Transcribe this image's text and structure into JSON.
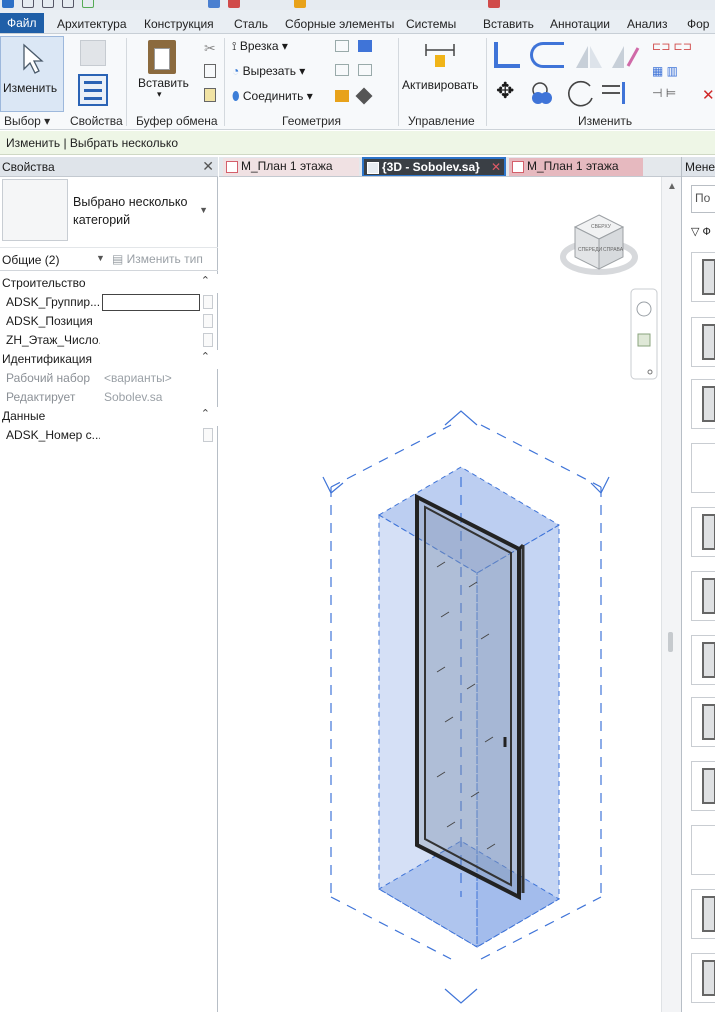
{
  "ribbon": {
    "tabs": [
      "Файл",
      "Архитектура",
      "Конструкция",
      "Сталь",
      "Сборные элементы",
      "Системы",
      "Вставить",
      "Аннотации",
      "Анализ",
      "Фор"
    ],
    "modify_label": "Изменить",
    "paste_label": "Вставить",
    "cut_menu": "Врезка",
    "cut_menu2": "Вырезать",
    "join_menu": "Соединить",
    "activate_label": "Активировать",
    "panels": {
      "select": "Выбор ▾",
      "properties": "Свойства",
      "clipboard": "Буфер обмена",
      "geometry": "Геометрия",
      "control": "Управление",
      "modify": "Изменить"
    }
  },
  "context_bar": "Изменить | Выбрать несколько",
  "properties": {
    "title": "Свойства",
    "type_line1": "Выбрано несколько",
    "type_line2": "категорий",
    "filter": "Общие (2)",
    "edit_type": "Изменить тип",
    "groups": [
      {
        "name": "Строительство",
        "rows": [
          {
            "key": "ADSK_Группир...",
            "value": ""
          },
          {
            "key": "ADSK_Позиция",
            "value": ""
          },
          {
            "key": "ZH_Этаж_Число...",
            "value": ""
          }
        ]
      },
      {
        "name": "Идентификация",
        "rows": [
          {
            "key": "Рабочий набор",
            "value": "<варианты>"
          },
          {
            "key": "Редактирует",
            "value": "Sobolev.sa"
          }
        ]
      },
      {
        "name": "Данные",
        "rows": [
          {
            "key": "ADSK_Номер с...",
            "value": ""
          }
        ]
      }
    ]
  },
  "view_tabs": [
    {
      "label": "М_План 1 этажа",
      "active": false
    },
    {
      "label": "{3D - Sobolev.sa}",
      "active": true
    },
    {
      "label": "М_План 1 этажа",
      "active": false
    }
  ],
  "viewcube": {
    "face_top": "СВЕРХУ",
    "face_front": "СПЕРЕДИ",
    "face_right": "СПРАВА"
  },
  "browser": {
    "title": "Менед",
    "search_placeholder": "По",
    "filter_label": "▽ Ф"
  },
  "colors": {
    "accent": "#1f5fa8",
    "selection": "#3f74d8",
    "context_bar": "#eef6e6",
    "tab_pink": "#e6b9bf"
  }
}
